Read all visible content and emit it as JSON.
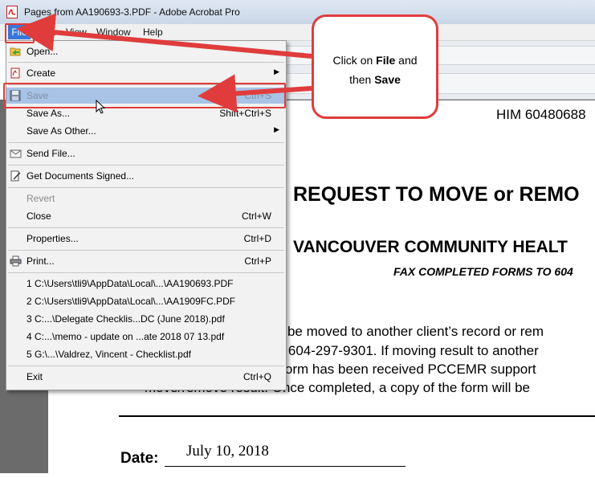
{
  "window": {
    "title": "Pages from AA190693-3.PDF - Adobe Acrobat Pro"
  },
  "menubar": {
    "file": "File",
    "edit": "Edit",
    "view": "View",
    "window": "Window",
    "help": "Help"
  },
  "file_menu": {
    "open": "Open...",
    "create": "Create",
    "save": "Save",
    "save_shortcut": "Ctrl+S",
    "save_as": "Save As...",
    "save_as_shortcut": "Shift+Ctrl+S",
    "save_as_other": "Save As Other...",
    "send_file": "Send File...",
    "get_signed": "Get Documents Signed...",
    "revert": "Revert",
    "close": "Close",
    "close_shortcut": "Ctrl+W",
    "properties": "Properties...",
    "properties_shortcut": "Ctrl+D",
    "print": "Print...",
    "print_shortcut": "Ctrl+P",
    "recent": [
      "1 C:\\Users\\tli9\\AppData\\Local\\...\\AA190693.PDF",
      "2 C:\\Users\\tli9\\AppData\\Local\\...\\AA1909FC.PDF",
      "3 C:...\\Delegate Checklis...DC (June 2018).pdf",
      "4 C:...\\memo - update on ...ate 2018 07 13.pdf",
      "5 G:\\...\\Valdrez, Vincent - Checklist.pdf"
    ],
    "exit": "Exit",
    "exit_shortcut": "Ctrl+Q"
  },
  "callout": {
    "line1_prefix": "Click on ",
    "line1_bold": "File",
    "line1_suffix": " and",
    "line2_prefix": "then ",
    "line2_bold": "Save"
  },
  "document": {
    "him": "HIM 60480688",
    "title": "REQUEST TO MOVE or REMO",
    "subtitle": "VANCOUVER COMMUNITY HEALT",
    "fax": "FAX COMPLETED FORMS TO 604",
    "line1": "ld be moved to another client’s record or rem",
    "line2": "to 604-297-9301. If moving result to another",
    "line3": "d form has been received PCCEMR support",
    "line4": "move/remove result.  Once completed, a copy of the form will be",
    "date_label": "Date:",
    "date_value": "July 10, 2018"
  },
  "colors": {
    "highlight_red": "#e03c3c",
    "menu_selected": "#a8c3e6",
    "file_menu_active": "#3a77d8"
  }
}
